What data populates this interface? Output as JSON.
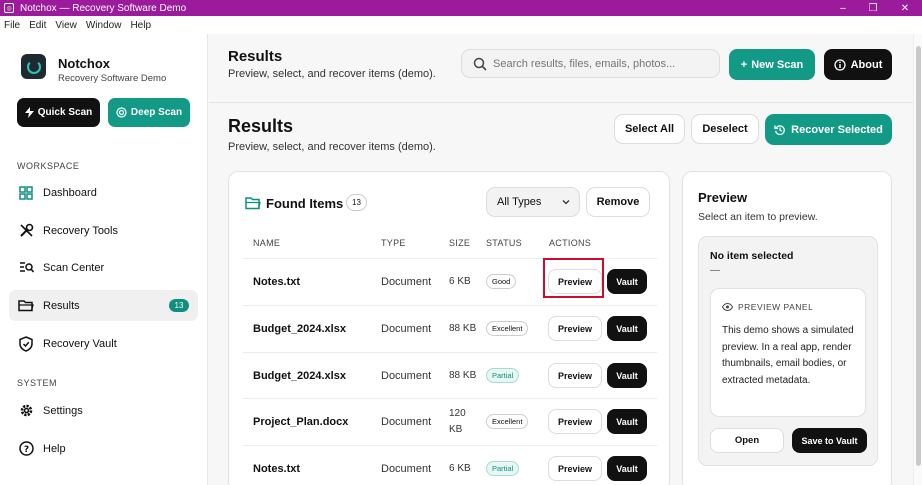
{
  "window": {
    "title": "Notchox — Recovery Software Demo"
  },
  "menu": [
    "File",
    "Edit",
    "View",
    "Window",
    "Help"
  ],
  "sidebar": {
    "brand_name": "Notchox",
    "brand_sub": "Recovery Software Demo",
    "quick_scan": "Quick Scan",
    "deep_scan": "Deep Scan",
    "workspace_label": "WORKSPACE",
    "system_label": "SYSTEM",
    "items": [
      {
        "label": "Dashboard",
        "icon": "grid-icon"
      },
      {
        "label": "Recovery Tools",
        "icon": "tools-icon"
      },
      {
        "label": "Scan Center",
        "icon": "scan-icon"
      },
      {
        "label": "Results",
        "icon": "folder-icon",
        "badge": "13",
        "active": true
      },
      {
        "label": "Recovery Vault",
        "icon": "shield-icon"
      }
    ],
    "system_items": [
      {
        "label": "Settings",
        "icon": "gear-icon"
      },
      {
        "label": "Help",
        "icon": "help-icon"
      }
    ]
  },
  "header": {
    "title": "Results",
    "subtitle": "Preview, select, and recover items (demo).",
    "search_placeholder": "Search results, files, emails, photos...",
    "new_scan": "New Scan",
    "about": "About"
  },
  "section": {
    "title": "Results",
    "subtitle": "Preview, select, and recover items (demo).",
    "select_all": "Select All",
    "deselect": "Deselect",
    "recover_selected": "Recover Selected"
  },
  "found": {
    "title": "Found Items",
    "count": "13",
    "type_filter": "All Types",
    "remove": "Remove",
    "columns": [
      "NAME",
      "TYPE",
      "SIZE",
      "STATUS",
      "ACTIONS"
    ],
    "preview_label": "Preview",
    "vault_label": "Vault",
    "rows": [
      {
        "name": "Notes.txt",
        "type": "Document",
        "size": "6 KB",
        "status": "Good",
        "status_kind": "neutral"
      },
      {
        "name": "Budget_2024.xlsx",
        "type": "Document",
        "size": "88 KB",
        "status": "Excellent",
        "status_kind": "neutral"
      },
      {
        "name": "Budget_2024.xlsx",
        "type": "Document",
        "size": "88 KB",
        "status": "Partial",
        "status_kind": "partial"
      },
      {
        "name": "Project_Plan.docx",
        "type": "Document",
        "size": "120 KB",
        "status": "Excellent",
        "status_kind": "neutral"
      },
      {
        "name": "Notes.txt",
        "type": "Document",
        "size": "6 KB",
        "status": "Partial",
        "status_kind": "partial"
      }
    ]
  },
  "preview": {
    "title": "Preview",
    "subtitle": "Select an item to preview.",
    "none_selected": "No item selected",
    "dash": "—",
    "panel_head": "PREVIEW PANEL",
    "panel_body": "This demo shows a simulated preview. In a real app, render thumbnails, email bodies, or extracted metadata.",
    "open": "Open",
    "save_vault": "Save to Vault"
  },
  "colors": {
    "titlebar": "#9c1a9c",
    "accent": "#129a86",
    "dark": "#111111",
    "highlight": "#c8102e"
  }
}
